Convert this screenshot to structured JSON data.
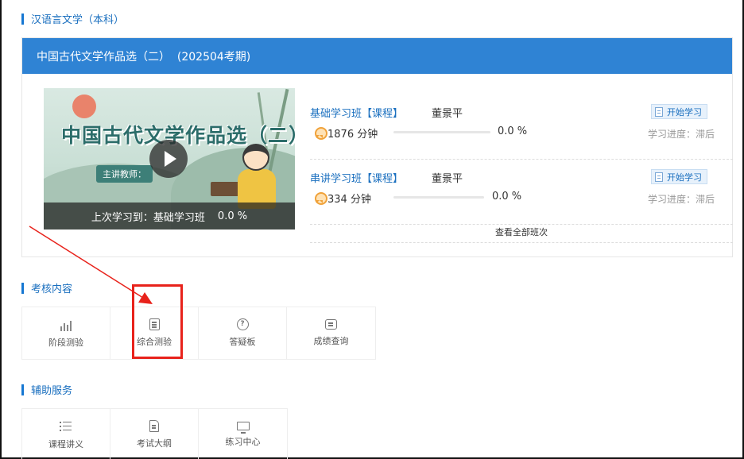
{
  "major_title": "汉语言文学（本科）",
  "course": {
    "header": "中国古代文学作品选（二）  (202504考期)",
    "thumbnail": {
      "title_art": "中国古代文学作品选（二）",
      "teacher_tag": "主讲教师：",
      "last_study_label": "上次学习到：基础学习班",
      "last_study_pct": "0.0 %"
    },
    "classes": [
      {
        "name": "基础学习班【课程】",
        "teacher": "董景平",
        "duration": "1876 分钟",
        "progress": 0.0,
        "pct": "0.0 %",
        "button": "开始学习",
        "status": "学习进度：滞后"
      },
      {
        "name": "串讲学习班【课程】",
        "teacher": "董景平",
        "duration": "334 分钟",
        "progress": 0.0,
        "pct": "0.0 %",
        "button": "开始学习",
        "status": "学习进度：滞后"
      }
    ],
    "view_all": "查看全部班次"
  },
  "assessment": {
    "title": "考核内容",
    "tiles": [
      {
        "label": "阶段测验",
        "icon": "bar-chart-icon"
      },
      {
        "label": "综合测验",
        "icon": "document-list-icon"
      },
      {
        "label": "答疑板",
        "icon": "question-circle-icon"
      },
      {
        "label": "成绩查询",
        "icon": "message-lines-icon"
      }
    ]
  },
  "support": {
    "title": "辅助服务",
    "tiles": [
      {
        "label": "课程讲义",
        "icon": "list-icon"
      },
      {
        "label": "考试大纲",
        "icon": "file-text-icon"
      },
      {
        "label": "练习中心",
        "icon": "monitor-check-icon"
      }
    ]
  },
  "colors": {
    "accent": "#2f83d4",
    "link": "#1a6fbf",
    "annotation": "#e8221b"
  }
}
